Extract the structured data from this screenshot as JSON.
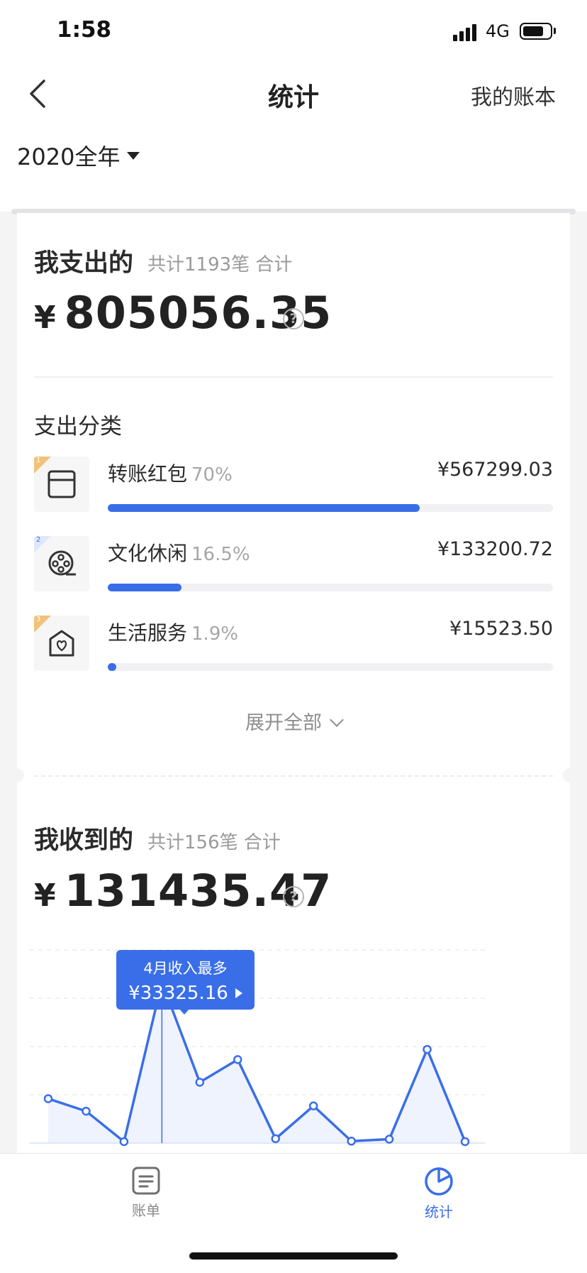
{
  "status_bar": {
    "time": "1:58",
    "network": "4G"
  },
  "nav": {
    "title": "统计",
    "right_link": "我的账本"
  },
  "period": {
    "label": "2020全年"
  },
  "expense": {
    "title": "我支出的",
    "summary": "共计1193笔 合计",
    "currency": "¥",
    "total": "805056.35",
    "category_heading": "支出分类",
    "categories": [
      {
        "rank": "1",
        "name": "转账红包",
        "percent": "70%",
        "amount": "¥567299.03",
        "share": 0.7,
        "icon": "wallet-icon"
      },
      {
        "rank": "2",
        "name": "文化休闲",
        "percent": "16.5%",
        "amount": "¥133200.72",
        "share": 0.165,
        "icon": "film-reel-icon"
      },
      {
        "rank": "3",
        "name": "生活服务",
        "percent": "1.9%",
        "amount": "¥15523.50",
        "share": 0.019,
        "icon": "home-heart-icon"
      }
    ],
    "expand_label": "展开全部"
  },
  "income": {
    "title": "我收到的",
    "summary": "共计156笔 合计",
    "currency": "¥",
    "total": "131435.47",
    "tooltip": {
      "title": "4月收入最多",
      "amount": "¥33325.16"
    }
  },
  "chart_data": {
    "type": "line",
    "x": [
      1,
      2,
      3,
      4,
      5,
      6,
      7,
      8,
      9,
      10,
      11,
      12
    ],
    "series": [
      {
        "values": [
          9200,
          6600,
          300,
          33325.16,
          12600,
          17300,
          900,
          7700,
          400,
          800,
          19400,
          300
        ]
      }
    ],
    "ylim": [
      0,
      40000
    ],
    "grid": true,
    "highlight_index": 3,
    "color": "#3a6ee8"
  },
  "tabbar": {
    "tabs": [
      {
        "label": "账单",
        "icon": "bill-icon"
      },
      {
        "label": "统计",
        "icon": "pie-chart-icon"
      }
    ]
  }
}
